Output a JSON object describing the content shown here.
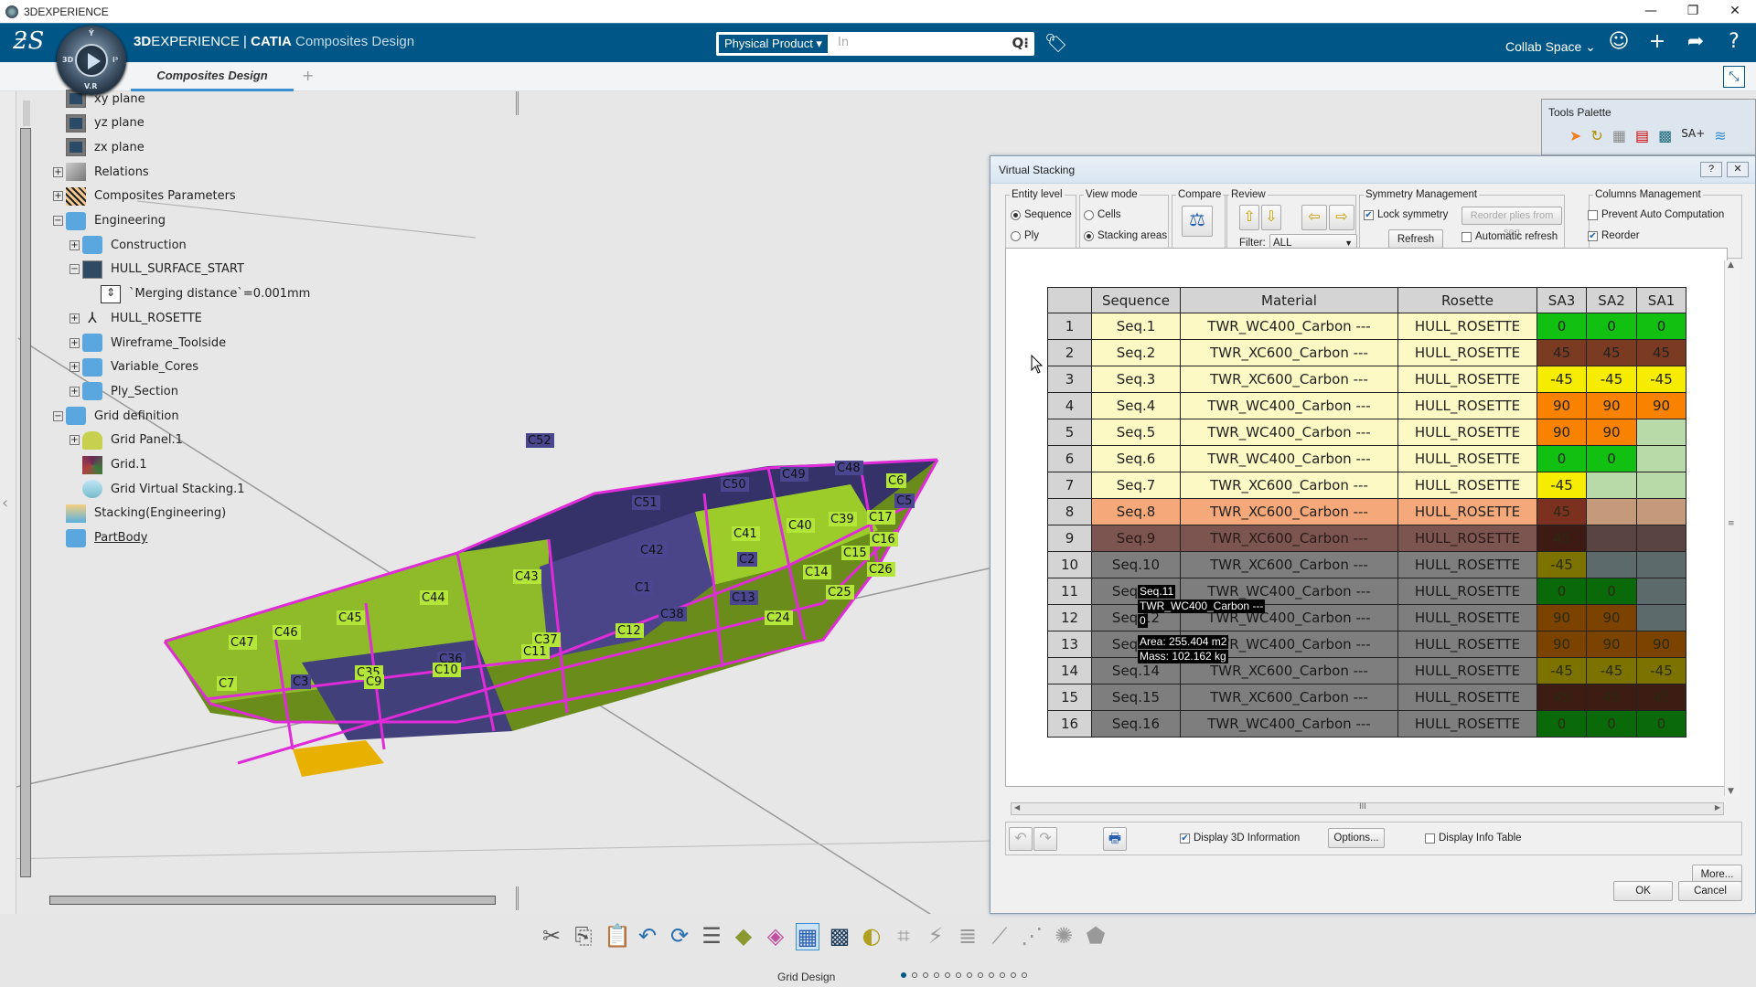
{
  "window": {
    "title": "3DEXPERIENCE",
    "controls": [
      "—",
      "❐",
      "✕"
    ]
  },
  "topbar": {
    "brand_bold": "3D",
    "brand_rest": "EXPERIENCE | ",
    "brand_app": "CATIA",
    "brand_sub": "Composites Design",
    "compass_labels": {
      "top": "Ÿ",
      "left": "3D",
      "right": "i³",
      "bottom": "V.R"
    },
    "search_scope": "Physical Product ▾",
    "search_placeholder": "In",
    "collab_space": "Collab Space ⌄",
    "icons": [
      "user-icon",
      "plus-icon",
      "share-icon",
      "help-icon"
    ]
  },
  "tabs": [
    {
      "label": "Composites Design",
      "active": true
    }
  ],
  "tab_add": "+",
  "tree": [
    {
      "label": "xy plane",
      "icon": "plane"
    },
    {
      "label": "yz plane",
      "icon": "plane"
    },
    {
      "label": "zx plane",
      "icon": "plane"
    },
    {
      "label": "Relations",
      "icon": "relations",
      "expander": "+"
    },
    {
      "label": "Composites Parameters",
      "icon": "composites",
      "expander": "+"
    },
    {
      "label": "Engineering",
      "icon": "geoset",
      "expander": "−"
    },
    {
      "label": "Construction",
      "icon": "geoset",
      "expander": "+"
    },
    {
      "label": "HULL_SURFACE_START",
      "icon": "surface",
      "expander": "−"
    },
    {
      "label": "`Merging distance`=0.001mm",
      "icon": "parameter"
    },
    {
      "label": "HULL_ROSETTE",
      "icon": "rosette",
      "expander": "+"
    },
    {
      "label": "Wireframe_Toolside",
      "icon": "geoset",
      "expander": "+"
    },
    {
      "label": "Variable_Cores",
      "icon": "geoset",
      "expander": "+"
    },
    {
      "label": "Ply_Section",
      "icon": "geoset",
      "expander": "+"
    },
    {
      "label": "Grid definition",
      "icon": "geoset",
      "expander": "−"
    },
    {
      "label": "Grid Panel.1",
      "icon": "grid-panel",
      "expander": "+"
    },
    {
      "label": "Grid.1",
      "icon": "grid"
    },
    {
      "label": "Grid Virtual Stacking.1",
      "icon": "grid-virtual-stacking"
    },
    {
      "label": "Stacking(Engineering)",
      "icon": "stacking"
    },
    {
      "label": "PartBody",
      "icon": "partbody"
    }
  ],
  "model_labels": [
    "C52",
    "C51",
    "C50",
    "C49",
    "C48",
    "C6",
    "C5",
    "C17",
    "C16",
    "C15",
    "C26",
    "C14",
    "C25",
    "C24",
    "C13",
    "C2",
    "C1",
    "C42",
    "C41",
    "C40",
    "C39",
    "C38",
    "C12",
    "C43",
    "C44",
    "C45",
    "C46",
    "C47",
    "C7",
    "C37",
    "C11",
    "C36",
    "C10",
    "C35",
    "C9",
    "C3"
  ],
  "tools_palette": {
    "title": "Tools Palette",
    "icons": [
      "select-icon",
      "rotate-icon",
      "grid-icon",
      "stacking-table-icon",
      "cells-icon",
      "sa-plus-icon",
      "layers-icon"
    ],
    "sa_label": "SA+"
  },
  "dialog": {
    "title": "Virtual Stacking",
    "help": "?",
    "close": "✕",
    "entity_level": {
      "legend": "Entity level",
      "options": [
        {
          "label": "Sequence",
          "selected": true
        },
        {
          "label": "Ply",
          "selected": false
        }
      ]
    },
    "view_mode": {
      "legend": "View mode",
      "options": [
        {
          "label": "Cells",
          "selected": false
        },
        {
          "label": "Stacking areas",
          "selected": true
        }
      ]
    },
    "compare": {
      "legend": "Compare"
    },
    "review": {
      "legend": "Review",
      "filter_label": "Filter:",
      "filter_value": "ALL"
    },
    "symmetry": {
      "legend": "Symmetry Management",
      "lock_symmetry": "Lock symmetry",
      "lock_checked": true,
      "reorder_plies": "Reorder plies from seq",
      "refresh": "Refresh",
      "auto_refresh": "Automatic refresh",
      "auto_checked": false
    },
    "columns": {
      "legend": "Columns Management",
      "prevent": "Prevent Auto Computation",
      "prevent_checked": false,
      "reorder": "Reorder",
      "reorder_checked": true
    },
    "table": {
      "headers": [
        "",
        "Sequence",
        "Material",
        "Rosette",
        "SA3",
        "SA2",
        "SA1"
      ],
      "rows": [
        {
          "n": "1",
          "seq": "Seq.1",
          "mat": "TWR_WC400_Carbon ---",
          "ros": "HULL_ROSETTE",
          "bg": "#fdf9c4",
          "fg": "#222",
          "cells": [
            {
              "v": "0",
              "c": "#12c012"
            },
            {
              "v": "0",
              "c": "#12c012"
            },
            {
              "v": "0",
              "c": "#12c012"
            }
          ]
        },
        {
          "n": "2",
          "seq": "Seq.2",
          "mat": "TWR_XC600_Carbon ---",
          "ros": "HULL_ROSETTE",
          "bg": "#fdf9c4",
          "fg": "#222",
          "cells": [
            {
              "v": "45",
              "c": "#7b3b22"
            },
            {
              "v": "45",
              "c": "#7b3b22"
            },
            {
              "v": "45",
              "c": "#7b3b22"
            }
          ]
        },
        {
          "n": "3",
          "seq": "Seq.3",
          "mat": "TWR_XC600_Carbon ---",
          "ros": "HULL_ROSETTE",
          "bg": "#fdf9c4",
          "fg": "#222",
          "cells": [
            {
              "v": "-45",
              "c": "#f6ec00"
            },
            {
              "v": "-45",
              "c": "#f6ec00"
            },
            {
              "v": "-45",
              "c": "#f6ec00"
            }
          ]
        },
        {
          "n": "4",
          "seq": "Seq.4",
          "mat": "TWR_WC400_Carbon ---",
          "ros": "HULL_ROSETTE",
          "bg": "#fdf9c4",
          "fg": "#222",
          "cells": [
            {
              "v": "90",
              "c": "#f98300"
            },
            {
              "v": "90",
              "c": "#f98300"
            },
            {
              "v": "90",
              "c": "#f98300"
            }
          ]
        },
        {
          "n": "5",
          "seq": "Seq.5",
          "mat": "TWR_WC400_Carbon ---",
          "ros": "HULL_ROSETTE",
          "bg": "#fdf9c4",
          "fg": "#222",
          "cells": [
            {
              "v": "90",
              "c": "#f98300"
            },
            {
              "v": "90",
              "c": "#f98300"
            },
            {
              "v": "",
              "c": "#b8d9a8"
            }
          ]
        },
        {
          "n": "6",
          "seq": "Seq.6",
          "mat": "TWR_WC400_Carbon ---",
          "ros": "HULL_ROSETTE",
          "bg": "#fdf9c4",
          "fg": "#222",
          "cells": [
            {
              "v": "0",
              "c": "#12c012"
            },
            {
              "v": "0",
              "c": "#12c012"
            },
            {
              "v": "",
              "c": "#b8d9a8"
            }
          ]
        },
        {
          "n": "7",
          "seq": "Seq.7",
          "mat": "TWR_XC600_Carbon ---",
          "ros": "HULL_ROSETTE",
          "bg": "#fdf9c4",
          "fg": "#222",
          "cells": [
            {
              "v": "-45",
              "c": "#f6ec00"
            },
            {
              "v": "",
              "c": "#b8d9a8"
            },
            {
              "v": "",
              "c": "#b8d9a8"
            }
          ]
        },
        {
          "n": "8",
          "seq": "Seq.8",
          "mat": "TWR_XC600_Carbon ---",
          "ros": "HULL_ROSETTE",
          "bg": "#f5a97a",
          "fg": "#222",
          "cells": [
            {
              "v": "45",
              "c": "#7b3020"
            },
            {
              "v": "",
              "c": "#c59a7a"
            },
            {
              "v": "",
              "c": "#c59a7a"
            }
          ]
        },
        {
          "n": "9",
          "seq": "Seq.9",
          "mat": "TWR_XC600_Carbon ---",
          "ros": "HULL_ROSETTE",
          "bg": "#7d5550",
          "fg": "#2a1a18",
          "cells": [
            {
              "v": "45",
              "c": "#3d1a14"
            },
            {
              "v": "",
              "c": "#5a4442"
            },
            {
              "v": "",
              "c": "#5a4442"
            }
          ]
        },
        {
          "n": "10",
          "seq": "Seq.10",
          "mat": "TWR_XC600_Carbon ---",
          "ros": "HULL_ROSETTE",
          "bg": "#7e7e7e",
          "fg": "#1a1a1a",
          "cells": [
            {
              "v": "-45",
              "c": "#7c7200"
            },
            {
              "v": "",
              "c": "#5c6a6c"
            },
            {
              "v": "",
              "c": "#5c6a6c"
            }
          ]
        },
        {
          "n": "11",
          "seq": "Seq.11",
          "mat": "TWR_WC400_Carbon ---",
          "ros": "HULL_ROSETTE",
          "bg": "#7e7e7e",
          "fg": "#1a1a1a",
          "cells": [
            {
              "v": "0",
              "c": "#0a6a0a"
            },
            {
              "v": "0",
              "c": "#0a6a0a"
            },
            {
              "v": "",
              "c": "#5c6a6c"
            }
          ]
        },
        {
          "n": "12",
          "seq": "Seq.12",
          "mat": "TWR_WC400_Carbon ---",
          "ros": "HULL_ROSETTE",
          "bg": "#7e7e7e",
          "fg": "#1a1a1a",
          "cells": [
            {
              "v": "90",
              "c": "#7c4200"
            },
            {
              "v": "90",
              "c": "#7c4200"
            },
            {
              "v": "",
              "c": "#5c6a6c"
            }
          ]
        },
        {
          "n": "13",
          "seq": "Seq.13",
          "mat": "TWR_WC400_Carbon ---",
          "ros": "HULL_ROSETTE",
          "bg": "#7e7e7e",
          "fg": "#1a1a1a",
          "cells": [
            {
              "v": "90",
              "c": "#7c4200"
            },
            {
              "v": "90",
              "c": "#7c4200"
            },
            {
              "v": "90",
              "c": "#7c4200"
            }
          ]
        },
        {
          "n": "14",
          "seq": "Seq.14",
          "mat": "TWR_XC600_Carbon ---",
          "ros": "HULL_ROSETTE",
          "bg": "#7e7e7e",
          "fg": "#1a1a1a",
          "cells": [
            {
              "v": "-45",
              "c": "#7c7200"
            },
            {
              "v": "-45",
              "c": "#7c7200"
            },
            {
              "v": "-45",
              "c": "#7c7200"
            }
          ]
        },
        {
          "n": "15",
          "seq": "Seq.15",
          "mat": "TWR_XC600_Carbon ---",
          "ros": "HULL_ROSETTE",
          "bg": "#7e7e7e",
          "fg": "#1a1a1a",
          "cells": [
            {
              "v": "45",
              "c": "#3d1c14"
            },
            {
              "v": "45",
              "c": "#3d1c14"
            },
            {
              "v": "45",
              "c": "#3d1c14"
            }
          ]
        },
        {
          "n": "16",
          "seq": "Seq.16",
          "mat": "TWR_WC400_Carbon ---",
          "ros": "HULL_ROSETTE",
          "bg": "#7e7e7e",
          "fg": "#1a1a1a",
          "cells": [
            {
              "v": "0",
              "c": "#0a6a0a"
            },
            {
              "v": "0",
              "c": "#0a6a0a"
            },
            {
              "v": "0",
              "c": "#0a6a0a"
            }
          ]
        }
      ]
    },
    "tooltip": {
      "line1": "Seq.11",
      "line2": "TWR_WC400_Carbon ---",
      "line3": "0",
      "area": "Area: 255.404 m2",
      "mass": "Mass: 102.162 kg"
    },
    "display_3d": "Display 3D Information",
    "display_3d_checked": true,
    "options": "Options...",
    "display_info_table": "Display Info Table",
    "display_info_checked": false,
    "more": "More...",
    "ok": "OK",
    "cancel": "Cancel"
  },
  "bottom_toolbar": {
    "section_label": "Grid Design",
    "page_dots": 12,
    "active_dot": 0,
    "icons": [
      "cut-icon",
      "copy-icon",
      "paste-icon",
      "undo-icon",
      "update-icon",
      "properties-icon",
      "grid-panel-icon",
      "grid-icon",
      "virtual-stacking-icon",
      "stacking-table-icon",
      "surface-icon",
      "ply-icon",
      "drop-off-icon",
      "stacking-icon",
      "edge-icon",
      "transition-icon",
      "producibility-icon",
      "flatten-icon"
    ]
  }
}
